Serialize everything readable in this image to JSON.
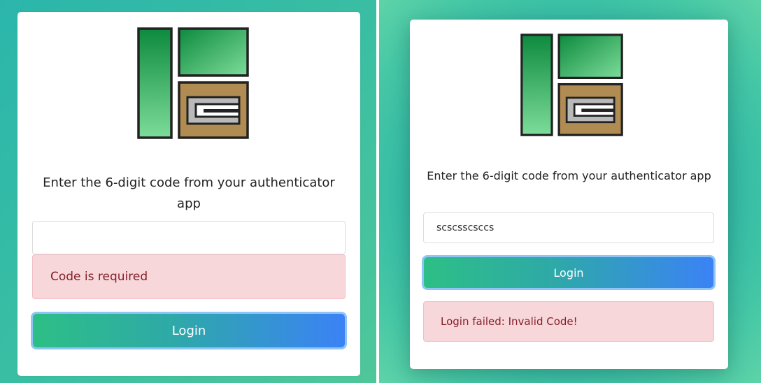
{
  "colors": {
    "logo_green_dark": "#0d8a3e",
    "logo_green_light": "#7ddc9a",
    "logo_brown": "#b08b52",
    "logo_gray": "#b9b9b9",
    "alert_bg": "#f8d7da",
    "alert_text": "#842029",
    "button_gradient_start": "#2dbf86",
    "button_gradient_end": "#3b82f6"
  },
  "left_screen": {
    "logo_icon": "company-logo",
    "prompt": "Enter the 6-digit code from your authenticator app",
    "code_input": {
      "value": "",
      "placeholder": ""
    },
    "error_alert": "Code is required",
    "login_button": "Login"
  },
  "right_screen": {
    "logo_icon": "company-logo",
    "prompt": "Enter the 6-digit code from your authenticator app",
    "code_input": {
      "value": "scscsscsccs",
      "placeholder": ""
    },
    "login_button": "Login",
    "error_alert": "Login failed: Invalid Code!"
  }
}
